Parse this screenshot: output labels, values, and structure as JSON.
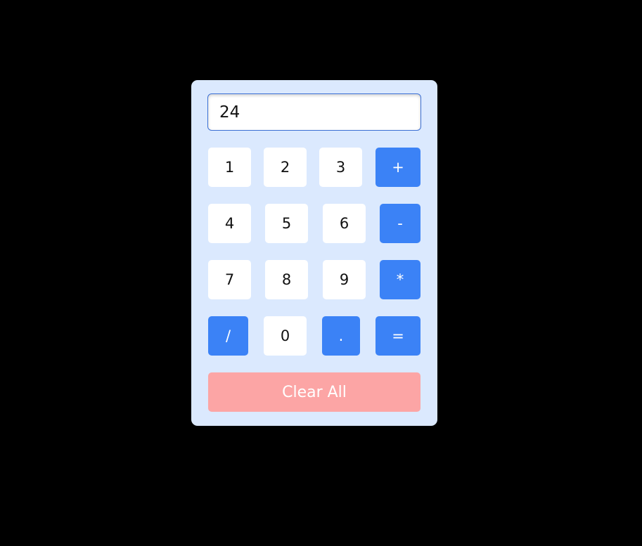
{
  "display": {
    "value": "24"
  },
  "rows": [
    [
      "1",
      "2",
      "3",
      "+"
    ],
    [
      "4",
      "5",
      "6",
      "-"
    ],
    [
      "7",
      "8",
      "9",
      "*"
    ],
    [
      "/",
      "0",
      ".",
      "="
    ]
  ],
  "clear_label": "Clear All",
  "colors": {
    "page_background": "#000000",
    "panel_background": "#dbe9fe",
    "number_key": "#ffffff",
    "operator_key": "#3b82f6",
    "clear_key": "#fca5a5"
  }
}
